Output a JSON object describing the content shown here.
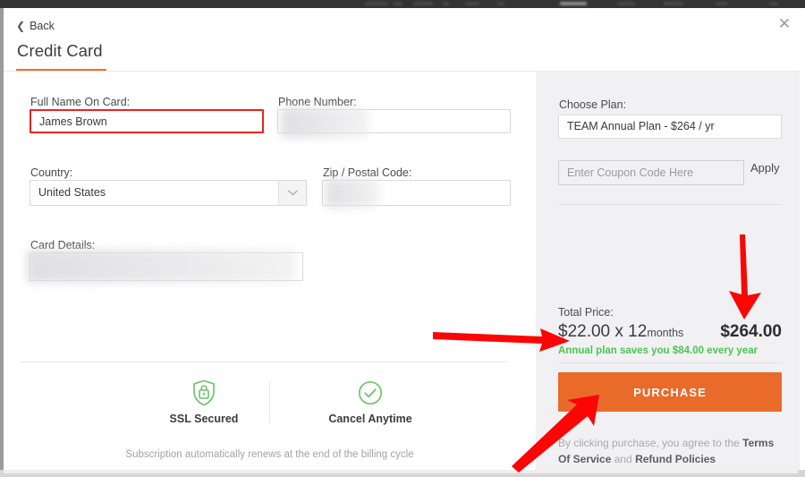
{
  "window": {
    "close_label": "✕",
    "back_label": "Back",
    "title": "Credit Card",
    "accent_color": "#ee6f2d"
  },
  "form": {
    "fields": [
      {
        "label": "Full Name On Card:",
        "value": "James Brown",
        "state": "error",
        "redacted": false
      },
      {
        "label": "Phone Number:",
        "value": "",
        "state": "normal",
        "redacted": true
      },
      {
        "label": "Country:",
        "value": "United States",
        "state": "select",
        "redacted": false
      },
      {
        "label": "Zip / Postal Code:",
        "value": "",
        "state": "normal",
        "redacted": true
      },
      {
        "label": "Card Details:",
        "value": "",
        "state": "normal",
        "redacted": true
      }
    ],
    "badges": [
      {
        "icon": "shield-lock-icon",
        "label": "SSL Secured",
        "color": "#6cc36f"
      },
      {
        "icon": "check-circle-icon",
        "label": "Cancel Anytime",
        "color": "#6cc36f"
      }
    ],
    "renew_note": "Subscription automatically renews at the end of the billing cycle"
  },
  "panel": {
    "choose_plan_label": "Choose Plan:",
    "selected_plan": "TEAM Annual Plan - $264 / yr",
    "coupon_placeholder": "Enter Coupon Code Here",
    "coupon_value": "",
    "apply_label": "Apply",
    "total_label": "Total Price:",
    "unit_price": "$22.00 x 12",
    "unit_period": "months",
    "grand_total": "$264.00",
    "savings_text": "Annual plan saves you $84.00 every year",
    "savings_color": "#4cc552",
    "purchase_label": "PURCHASE",
    "purchase_color": "#ea6a2a",
    "terms_prefix": "By clicking purchase, you agree to the ",
    "terms_link_1": "Terms Of Service",
    "terms_conjunction": " and ",
    "terms_link_2": "Refund Policies"
  },
  "annotations": {
    "color": "#fb0505",
    "arrows": [
      {
        "name": "arrow-to-grand-total",
        "direction": "down"
      },
      {
        "name": "arrow-to-savings",
        "direction": "right"
      },
      {
        "name": "arrow-to-purchase-button",
        "direction": "up-right"
      }
    ]
  }
}
